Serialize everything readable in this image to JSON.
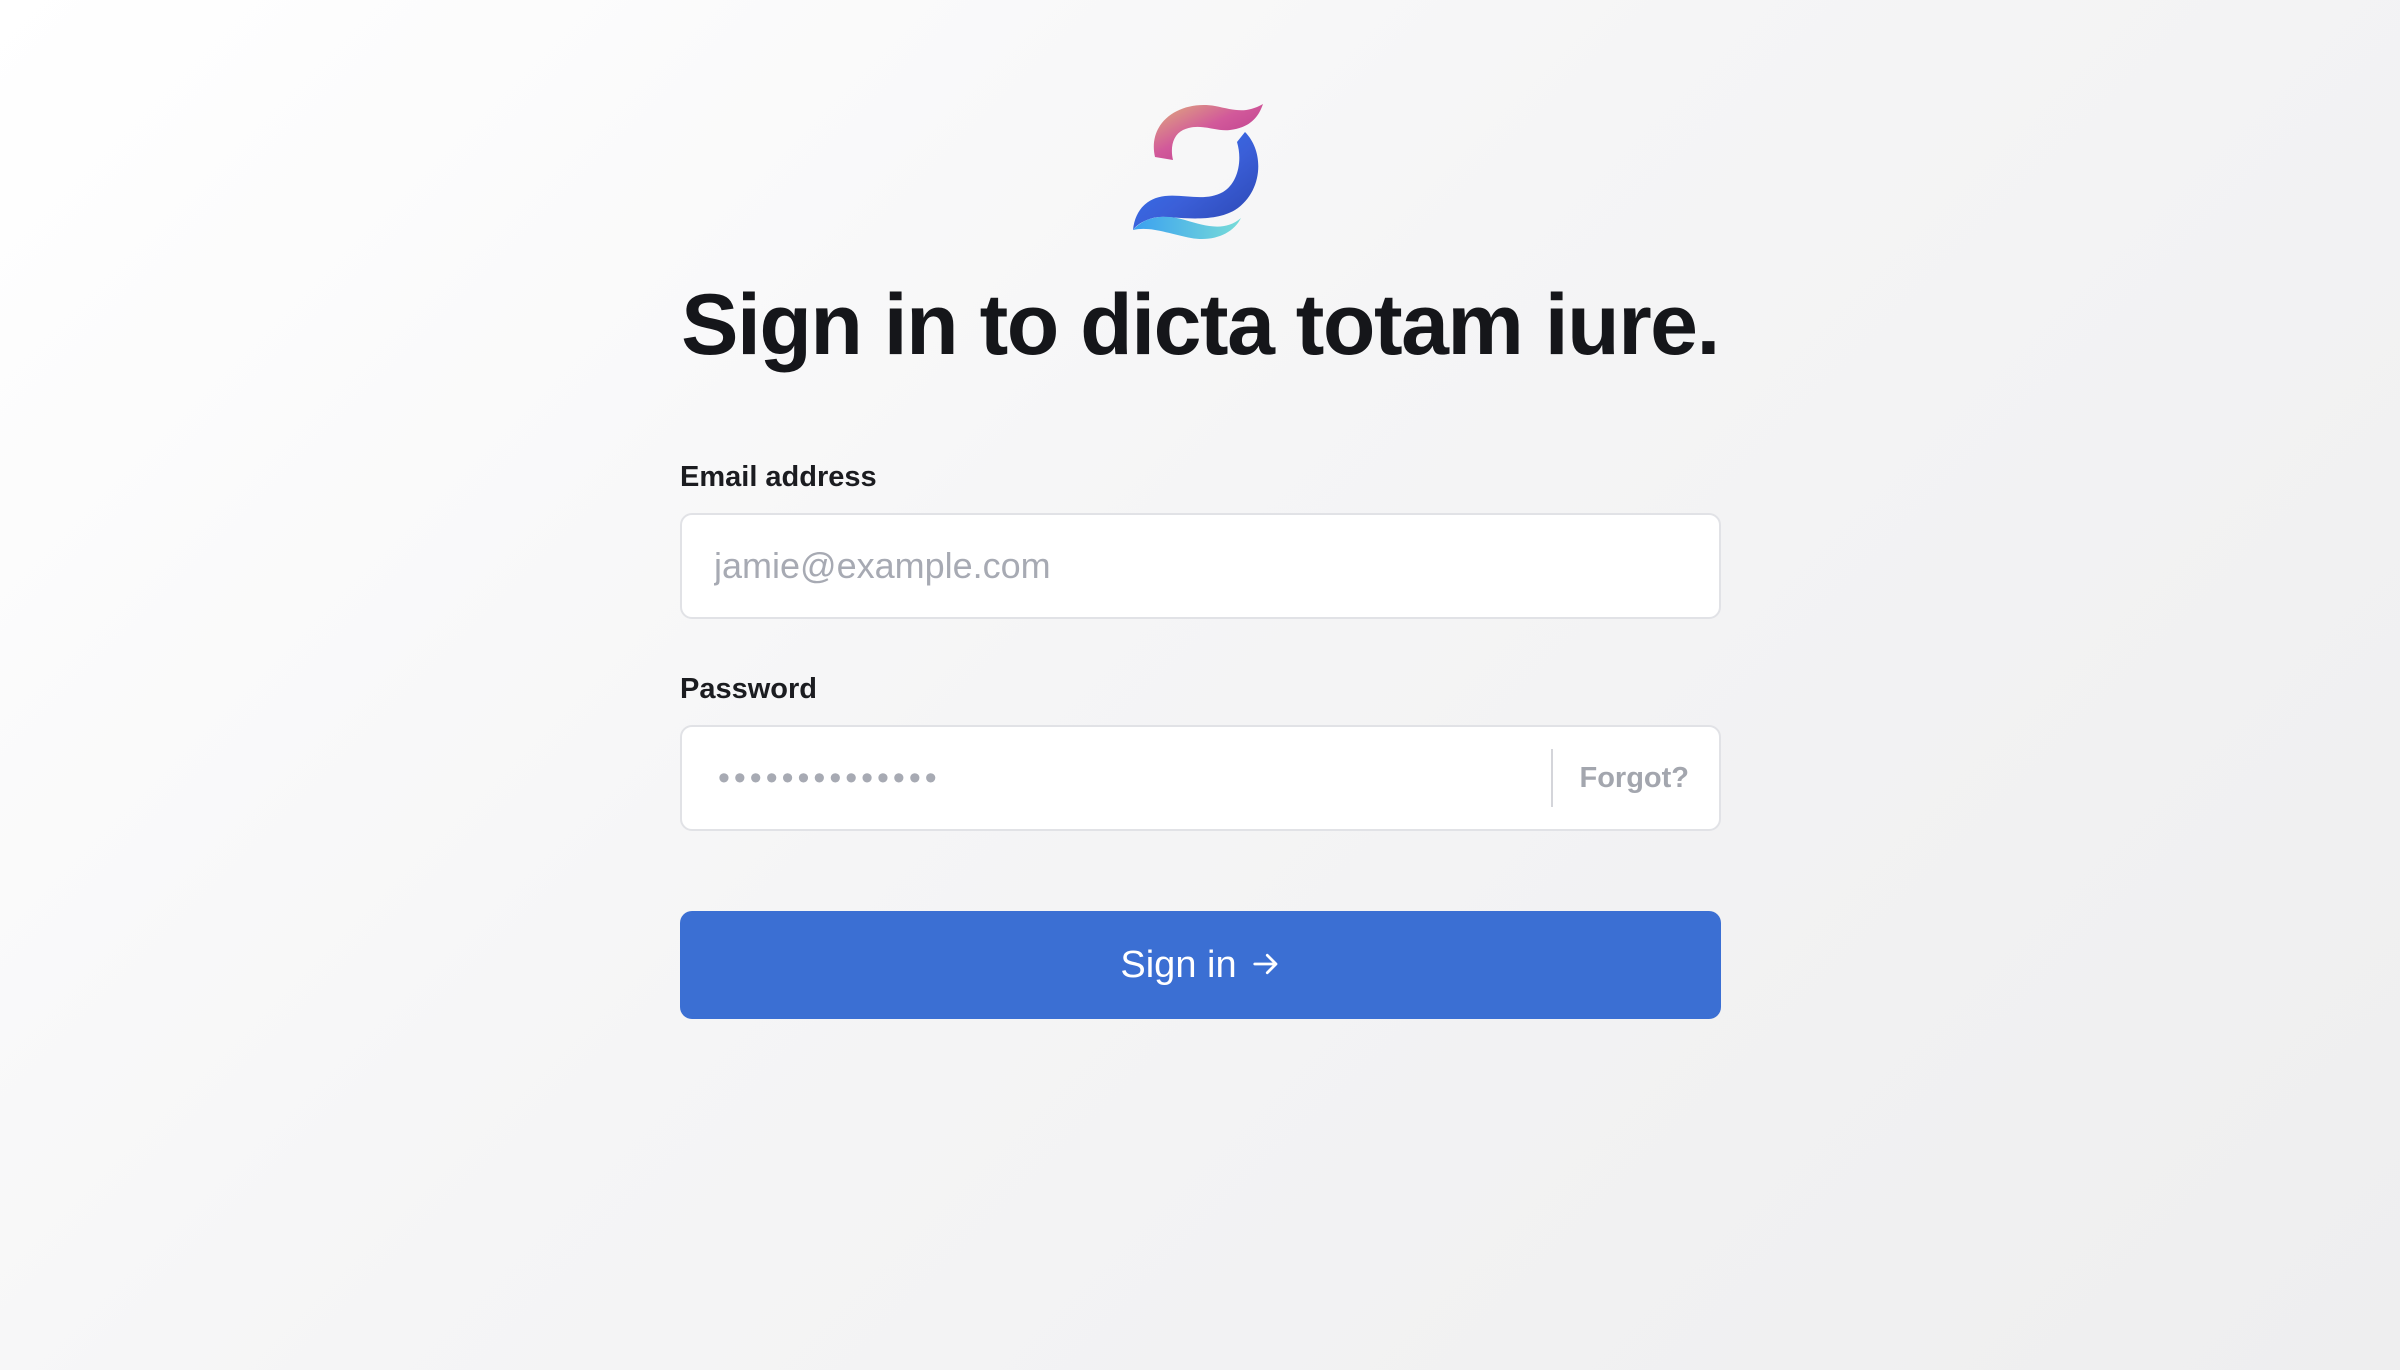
{
  "logo": {
    "icon": "brand-logo-icon",
    "colors": [
      "#d4a37e",
      "#c13b8b",
      "#3b82f6",
      "#67d3dd"
    ]
  },
  "title": "Sign in to dicta totam iure.",
  "email": {
    "label": "Email address",
    "placeholder": "jamie@example.com",
    "value": ""
  },
  "password": {
    "label": "Password",
    "masked_value": "••••••••••••••",
    "forgot_label": "Forgot?"
  },
  "submit": {
    "label": "Sign in",
    "icon": "arrow-right-icon",
    "color": "#3b6fd3"
  },
  "colors": {
    "accent": "#3b6fd3",
    "border": "#e1e2e6",
    "placeholder": "#a7aab3",
    "text": "#16171b"
  }
}
